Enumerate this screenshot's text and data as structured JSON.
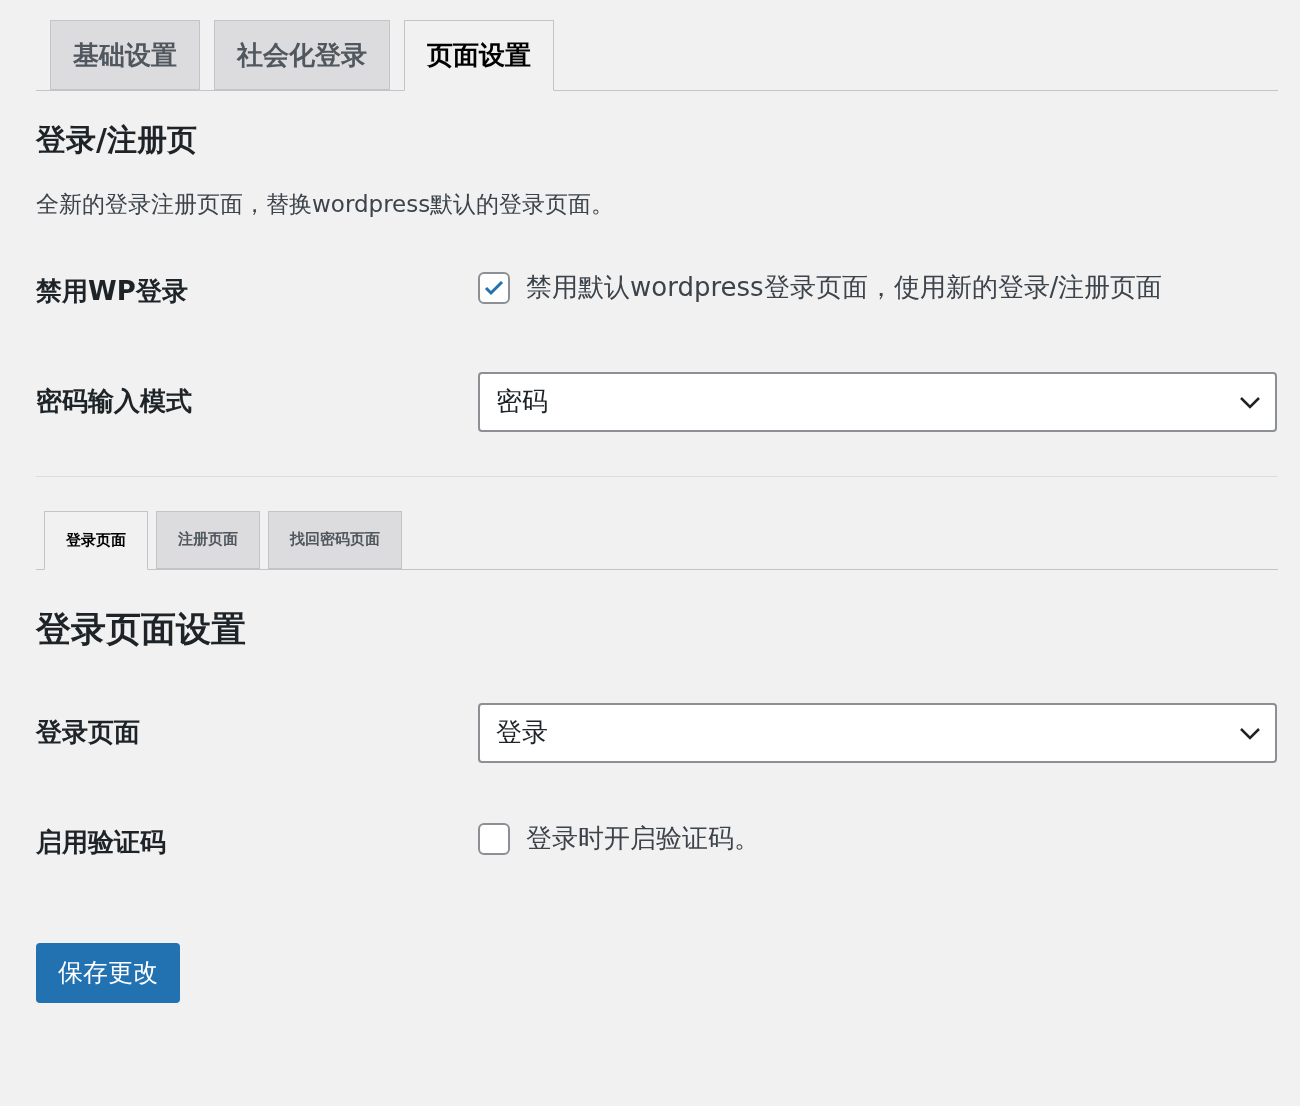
{
  "tabs": [
    {
      "label": "基础设置",
      "selected": false
    },
    {
      "label": "社会化登录",
      "selected": false
    },
    {
      "label": "页面设置",
      "selected": true
    }
  ],
  "section": {
    "title": "登录/注册页",
    "description": "全新的登录注册页面，替换wordpress默认的登录页面。"
  },
  "fields": [
    {
      "kind": "checkbox",
      "label": "禁用WP登录",
      "text": "禁用默认wordpress登录页面，使用新的登录/注册页面",
      "checked": true
    },
    {
      "kind": "select",
      "label": "密码输入模式",
      "value": "密码"
    }
  ],
  "subtabs": [
    {
      "label": "登录页面",
      "selected": true
    },
    {
      "label": "注册页面",
      "selected": false
    },
    {
      "label": "找回密码页面",
      "selected": false
    }
  ],
  "subsection": {
    "title": "登录页面设置"
  },
  "subfields": [
    {
      "kind": "select",
      "label": "登录页面",
      "value": "登录"
    },
    {
      "kind": "checkbox",
      "label": "启用验证码",
      "text": "登录时开启验证码。",
      "checked": false
    }
  ],
  "save_button": "保存更改"
}
